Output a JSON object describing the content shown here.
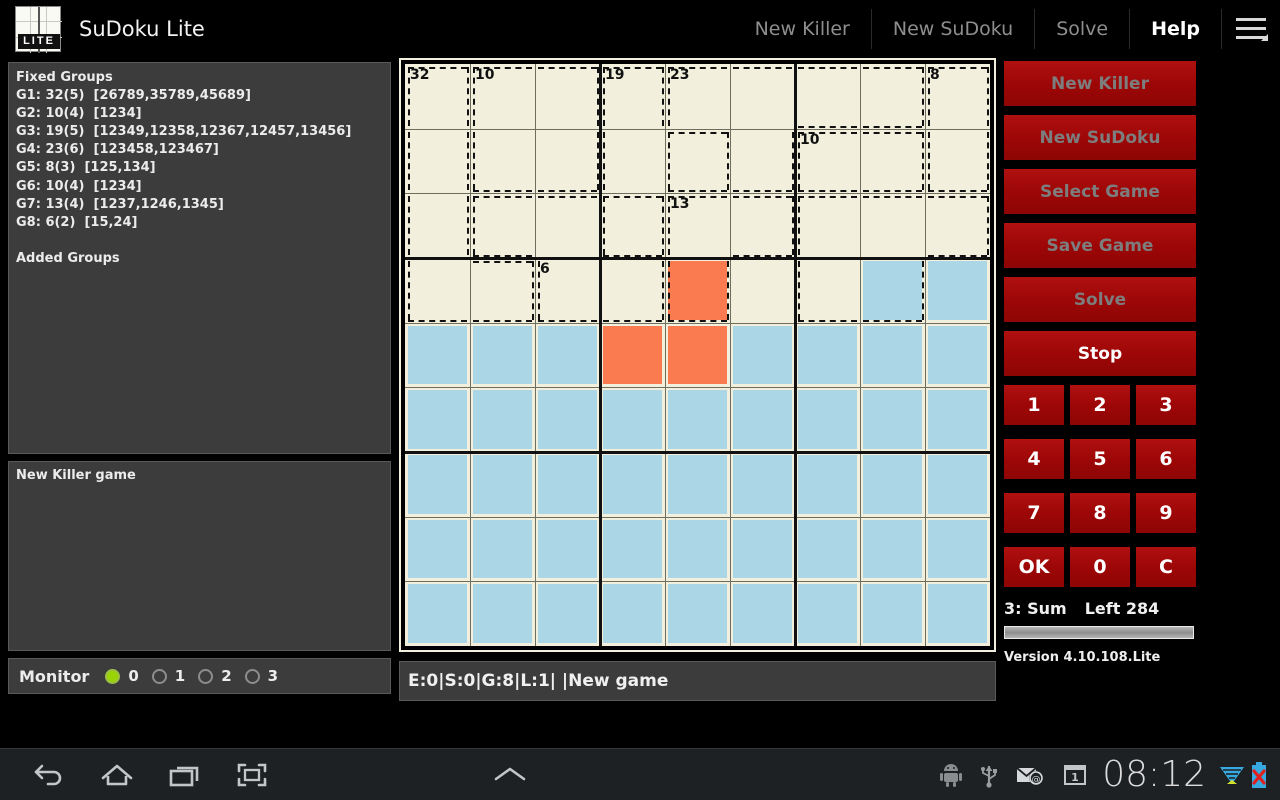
{
  "app": {
    "title": "SuDoku Lite",
    "logo_text": "LITE",
    "menu": [
      {
        "label": "New Killer",
        "enabled": false
      },
      {
        "label": "New SuDoku",
        "enabled": false
      },
      {
        "label": "Solve",
        "enabled": false
      },
      {
        "label": "Help",
        "enabled": true
      }
    ],
    "overflow_icon": "hamburger-menu-icon"
  },
  "groups_panel": {
    "heading": "Fixed Groups",
    "lines": [
      "G1: 32(5)  [26789,35789,45689]",
      "G2: 10(4)  [1234]",
      "G3: 19(5)  [12349,12358,12367,12457,13456]",
      "G4: 23(6)  [123458,123467]",
      "G5: 8(3)  [125,134]",
      "G6: 10(4)  [1234]",
      "G7: 13(4)  [1237,1246,1345]",
      "G8: 6(2)  [15,24]"
    ],
    "added_heading": "Added Groups"
  },
  "log_panel": {
    "text": "New Killer game"
  },
  "monitor": {
    "label": "Monitor",
    "options": [
      "0",
      "1",
      "2",
      "3"
    ],
    "selected": "0"
  },
  "statusbar": {
    "text": "E:0|S:0|G:8|L:1|  |New game"
  },
  "right_panel": {
    "buttons": [
      {
        "label": "New Killer",
        "enabled": false
      },
      {
        "label": "New SuDoku",
        "enabled": false
      },
      {
        "label": "Select Game",
        "enabled": false
      },
      {
        "label": "Save Game",
        "enabled": false
      },
      {
        "label": "Solve",
        "enabled": false
      },
      {
        "label": "Stop",
        "enabled": true
      }
    ],
    "keypad": [
      "1",
      "2",
      "3",
      "4",
      "5",
      "6",
      "7",
      "8",
      "9",
      "OK",
      "0",
      "C"
    ],
    "mode_label": "3: Sum",
    "left_label": "Left 284",
    "progress_percent": 100,
    "version": "Version 4.10.108.Lite"
  },
  "navbar": {
    "back_icon": "back-arrow-icon",
    "home_icon": "home-icon",
    "recents_icon": "recent-apps-icon",
    "screenshot_icon": "screenshot-icon",
    "android_icon": "android-robot-icon",
    "usb_icon": "usb-icon",
    "mail_icon": "email-icon",
    "notification_icon": "notification-count-icon",
    "notification_count": "1",
    "clock": "08:12",
    "wifi_icon": "wifi-signal-icon",
    "battery_icon": "battery-error-icon"
  },
  "colors": {
    "cell_empty": "#f2f0dc",
    "cell_given": "#aad6e6",
    "cell_selected": "#f97b4f",
    "button_red": "#a60b0b",
    "panel_gray": "#3c3c3c",
    "radio_on": "#9ad406"
  },
  "board": {
    "rows": 9,
    "cols": 9,
    "cell_states": [
      [
        "empty",
        "empty",
        "empty",
        "empty",
        "empty",
        "empty",
        "empty",
        "empty",
        "empty"
      ],
      [
        "empty",
        "empty",
        "empty",
        "empty",
        "empty",
        "empty",
        "empty",
        "empty",
        "empty"
      ],
      [
        "empty",
        "empty",
        "empty",
        "empty",
        "empty",
        "empty",
        "empty",
        "empty",
        "empty"
      ],
      [
        "empty",
        "empty",
        "empty",
        "empty",
        "selected",
        "empty",
        "empty",
        "given",
        "given"
      ],
      [
        "given",
        "given",
        "given",
        "selected",
        "selected",
        "given",
        "given",
        "given",
        "given"
      ],
      [
        "given",
        "given",
        "given",
        "given",
        "given",
        "given",
        "given",
        "given",
        "given"
      ],
      [
        "given",
        "given",
        "given",
        "given",
        "given",
        "given",
        "given",
        "given",
        "given"
      ],
      [
        "given",
        "given",
        "given",
        "given",
        "given",
        "given",
        "given",
        "given",
        "given"
      ],
      [
        "given",
        "given",
        "given",
        "given",
        "given",
        "given",
        "given",
        "given",
        "given"
      ]
    ],
    "cage_sums": [
      {
        "row": 0,
        "col": 0,
        "text": "32"
      },
      {
        "row": 0,
        "col": 1,
        "text": "10"
      },
      {
        "row": 0,
        "col": 3,
        "text": "19"
      },
      {
        "row": 0,
        "col": 4,
        "text": "23"
      },
      {
        "row": 0,
        "col": 8,
        "text": "8"
      },
      {
        "row": 1,
        "col": 6,
        "text": "10"
      },
      {
        "row": 2,
        "col": 4,
        "text": "13"
      },
      {
        "row": 3,
        "col": 2,
        "text": "6"
      }
    ],
    "cages": [
      {
        "id": "G1",
        "cells": [
          [
            0,
            0
          ],
          [
            1,
            0
          ],
          [
            2,
            0
          ],
          [
            3,
            0
          ],
          [
            3,
            1
          ]
        ]
      },
      {
        "id": "G2",
        "cells": [
          [
            0,
            1
          ],
          [
            0,
            2
          ],
          [
            1,
            1
          ],
          [
            1,
            2
          ]
        ]
      },
      {
        "id": "G2b",
        "cells": [
          [
            2,
            1
          ],
          [
            2,
            2
          ],
          [
            2,
            3
          ],
          [
            3,
            2
          ],
          [
            3,
            3
          ]
        ]
      },
      {
        "id": "G3",
        "cells": [
          [
            0,
            3
          ],
          [
            1,
            3
          ],
          [
            1,
            4
          ],
          [
            2,
            3
          ]
        ]
      },
      {
        "id": "G4",
        "cells": [
          [
            0,
            4
          ],
          [
            0,
            5
          ],
          [
            0,
            6
          ],
          [
            0,
            7
          ],
          [
            1,
            4
          ],
          [
            1,
            5
          ]
        ]
      },
      {
        "id": "G5",
        "cells": [
          [
            0,
            8
          ],
          [
            1,
            8
          ]
        ]
      },
      {
        "id": "G6",
        "cells": [
          [
            1,
            6
          ],
          [
            1,
            7
          ]
        ]
      },
      {
        "id": "G7",
        "cells": [
          [
            2,
            4
          ],
          [
            2,
            5
          ],
          [
            3,
            4
          ]
        ]
      },
      {
        "id": "G8",
        "cells": [
          [
            2,
            6
          ],
          [
            2,
            7
          ],
          [
            2,
            8
          ],
          [
            3,
            6
          ],
          [
            3,
            7
          ]
        ]
      }
    ]
  }
}
